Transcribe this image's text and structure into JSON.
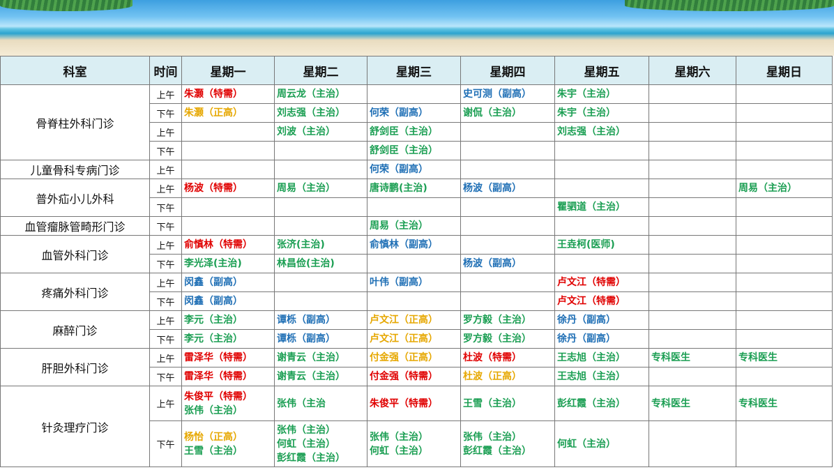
{
  "headers": [
    "科室",
    "时间",
    "星期一",
    "星期二",
    "星期三",
    "星期四",
    "星期五",
    "星期六",
    "星期日"
  ],
  "colors": {
    "red": "#e00000",
    "orange": "#e6a700",
    "green": "#1a9e52",
    "blue": "#1f6fb5"
  },
  "departments": [
    {
      "name": "骨脊柱外科门诊",
      "rows": [
        {
          "time": "上午",
          "cells": [
            [
              {
                "t": "朱灏（特需）",
                "c": "red"
              }
            ],
            [
              {
                "t": "周云龙（主治）",
                "c": "green"
              }
            ],
            [],
            [
              {
                "t": "史可测（副高）",
                "c": "blue"
              }
            ],
            [
              {
                "t": "朱宇（主治）",
                "c": "green"
              }
            ],
            [],
            []
          ]
        },
        {
          "time": "下午",
          "cells": [
            [
              {
                "t": "朱灏（正高）",
                "c": "orange"
              }
            ],
            [
              {
                "t": "刘志强（主治）",
                "c": "green"
              }
            ],
            [
              {
                "t": "何荣（副高）",
                "c": "blue"
              }
            ],
            [
              {
                "t": "谢侃（主治）",
                "c": "green"
              }
            ],
            [
              {
                "t": "朱宇（主治）",
                "c": "green"
              }
            ],
            [],
            []
          ]
        },
        {
          "time": "上午",
          "cells": [
            [],
            [
              {
                "t": "刘波（主治）",
                "c": "green"
              }
            ],
            [
              {
                "t": "舒剑臣（主治）",
                "c": "green"
              }
            ],
            [],
            [
              {
                "t": "刘志强（主治）",
                "c": "green"
              }
            ],
            [],
            []
          ]
        },
        {
          "time": "下午",
          "cells": [
            [],
            [],
            [
              {
                "t": "舒剑臣（主治）",
                "c": "green"
              }
            ],
            [],
            [],
            [],
            []
          ]
        }
      ]
    },
    {
      "name": "儿童骨科专病门诊",
      "rows": [
        {
          "time": "上午",
          "cells": [
            [],
            [],
            [
              {
                "t": "何荣（副高）",
                "c": "blue"
              }
            ],
            [],
            [],
            [],
            []
          ]
        }
      ]
    },
    {
      "name": "普外疝小儿外科",
      "rows": [
        {
          "time": "上午",
          "cells": [
            [
              {
                "t": "杨波（特需）",
                "c": "red"
              }
            ],
            [
              {
                "t": "周易（主治）",
                "c": "green"
              }
            ],
            [
              {
                "t": "唐诗鹏(主治)",
                "c": "green"
              }
            ],
            [
              {
                "t": "杨波（副高）",
                "c": "blue"
              }
            ],
            [],
            [],
            [
              {
                "t": "周易（主治）",
                "c": "green"
              }
            ]
          ]
        },
        {
          "time": "下午",
          "cells": [
            [],
            [],
            [],
            [],
            [
              {
                "t": "瞿驷道（主治）",
                "c": "green"
              }
            ],
            [],
            []
          ]
        }
      ]
    },
    {
      "name": "血管瘤脉管畸形门诊",
      "rows": [
        {
          "time": "下午",
          "cells": [
            [],
            [],
            [
              {
                "t": "周易（主治）",
                "c": "green"
              }
            ],
            [],
            [],
            [],
            []
          ]
        }
      ]
    },
    {
      "name": "血管外科门诊",
      "rows": [
        {
          "time": "上午",
          "cells": [
            [
              {
                "t": "俞慎林（特需）",
                "c": "red"
              }
            ],
            [
              {
                "t": "张济(主治)",
                "c": "green"
              }
            ],
            [
              {
                "t": "俞慎林（副高）",
                "c": "blue"
              }
            ],
            [],
            [
              {
                "t": "王垚柯(医师)",
                "c": "green"
              }
            ],
            [],
            []
          ]
        },
        {
          "time": "下午",
          "cells": [
            [
              {
                "t": "李光泽(主治)",
                "c": "green"
              }
            ],
            [
              {
                "t": "林昌俭(主治)",
                "c": "green"
              }
            ],
            [],
            [
              {
                "t": "杨波（副高）",
                "c": "blue"
              }
            ],
            [],
            [],
            []
          ]
        }
      ]
    },
    {
      "name": "疼痛外科门诊",
      "rows": [
        {
          "time": "上午",
          "cells": [
            [
              {
                "t": "闵鑫（副高）",
                "c": "blue"
              }
            ],
            [],
            [
              {
                "t": "叶伟（副高）",
                "c": "blue"
              }
            ],
            [],
            [
              {
                "t": "卢文江（特需）",
                "c": "red"
              }
            ],
            [],
            []
          ]
        },
        {
          "time": "下午",
          "cells": [
            [
              {
                "t": "闵鑫（副高）",
                "c": "blue"
              }
            ],
            [],
            [],
            [],
            [
              {
                "t": "卢文江（特需）",
                "c": "red"
              }
            ],
            [],
            []
          ]
        }
      ]
    },
    {
      "name": "麻醉门诊",
      "rows": [
        {
          "time": "上午",
          "cells": [
            [
              {
                "t": "李元（主治）",
                "c": "green"
              }
            ],
            [
              {
                "t": "谭栎（副高）",
                "c": "blue"
              }
            ],
            [
              {
                "t": "卢文江（正高）",
                "c": "orange"
              }
            ],
            [
              {
                "t": "罗方毅（主治）",
                "c": "green"
              }
            ],
            [
              {
                "t": "徐丹（副高）",
                "c": "blue"
              }
            ],
            [],
            []
          ]
        },
        {
          "time": "下午",
          "cells": [
            [
              {
                "t": "李元（主治）",
                "c": "green"
              }
            ],
            [
              {
                "t": "谭栎（副高）",
                "c": "blue"
              }
            ],
            [
              {
                "t": "卢文江（正高）",
                "c": "orange"
              }
            ],
            [
              {
                "t": "罗方毅（主治）",
                "c": "green"
              }
            ],
            [
              {
                "t": "徐丹（副高）",
                "c": "blue"
              }
            ],
            [],
            []
          ]
        }
      ]
    },
    {
      "name": "肝胆外科门诊",
      "rows": [
        {
          "time": "上午",
          "cells": [
            [
              {
                "t": "雷泽华（特需）",
                "c": "red"
              }
            ],
            [
              {
                "t": "谢青云（主治）",
                "c": "green"
              }
            ],
            [
              {
                "t": "付金强（正高）",
                "c": "orange"
              }
            ],
            [
              {
                "t": "杜波（特需）",
                "c": "red"
              }
            ],
            [
              {
                "t": "王志旭（主治）",
                "c": "green"
              }
            ],
            [
              {
                "t": "专科医生",
                "c": "green"
              }
            ],
            [
              {
                "t": "专科医生",
                "c": "green"
              }
            ]
          ]
        },
        {
          "time": "下午",
          "cells": [
            [
              {
                "t": "雷泽华（特需）",
                "c": "red"
              }
            ],
            [
              {
                "t": "谢青云（主治）",
                "c": "green"
              }
            ],
            [
              {
                "t": "付金强（特需）",
                "c": "red"
              }
            ],
            [
              {
                "t": "杜波（正高）",
                "c": "orange"
              }
            ],
            [
              {
                "t": "王志旭（主治）",
                "c": "green"
              }
            ],
            [],
            []
          ]
        }
      ]
    },
    {
      "name": "针灸理疗门诊",
      "rows": [
        {
          "time": "上午",
          "cells": [
            [
              {
                "t": "朱俊平（特需）",
                "c": "red"
              },
              {
                "t": "张伟（主治）",
                "c": "green"
              }
            ],
            [
              {
                "t": "张伟（主治",
                "c": "green"
              }
            ],
            [
              {
                "t": "朱俊平（特需）",
                "c": "red"
              }
            ],
            [
              {
                "t": "王雪（主治）",
                "c": "green"
              }
            ],
            [
              {
                "t": "彭红霞（主治）",
                "c": "green"
              }
            ],
            [
              {
                "t": "专科医生",
                "c": "green"
              }
            ],
            [
              {
                "t": "专科医生",
                "c": "green"
              }
            ]
          ]
        },
        {
          "time": "下午",
          "cells": [
            [
              {
                "t": "杨怡（正高）",
                "c": "orange"
              },
              {
                "t": "王雪（主治）",
                "c": "green"
              }
            ],
            [
              {
                "t": "张伟（主治）",
                "c": "green"
              },
              {
                "t": "何虹（主治）",
                "c": "green"
              },
              {
                "t": "彭红霞（主治）",
                "c": "green"
              }
            ],
            [
              {
                "t": "张伟（主治）",
                "c": "green"
              },
              {
                "t": "何虹（主治）",
                "c": "green"
              }
            ],
            [
              {
                "t": "张伟（主治）",
                "c": "green"
              },
              {
                "t": "彭红霞（主治）",
                "c": "green"
              }
            ],
            [
              {
                "t": "何虹（主治）",
                "c": "green"
              }
            ],
            [],
            []
          ]
        }
      ]
    }
  ]
}
